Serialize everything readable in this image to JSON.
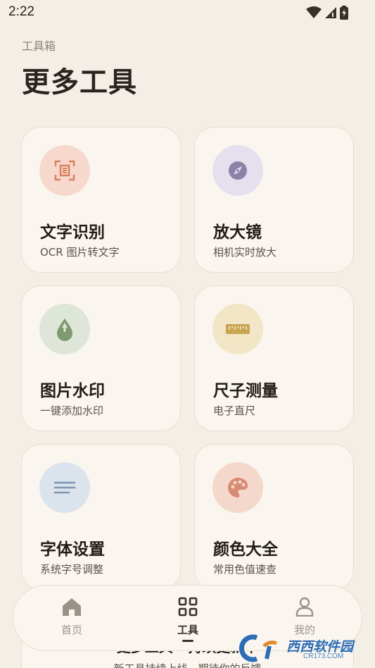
{
  "status_bar": {
    "time": "2:22"
  },
  "header": {
    "subtitle": "工具箱",
    "title": "更多工具"
  },
  "tools": [
    {
      "title": "文字识别",
      "desc": "OCR 图片转文字",
      "icon": "ocr-scan-icon",
      "icon_bg": "#f6d8cc"
    },
    {
      "title": "放大镜",
      "desc": "相机实时放大",
      "icon": "compass-icon",
      "icon_bg": "#e4e0ee"
    },
    {
      "title": "图片水印",
      "desc": "一键添加水印",
      "icon": "water-drop-icon",
      "icon_bg": "#dde6d8"
    },
    {
      "title": "尺子测量",
      "desc": "电子直尺",
      "icon": "ruler-icon",
      "icon_bg": "#f2e6c6"
    },
    {
      "title": "字体设置",
      "desc": "系统字号调整",
      "icon": "text-lines-icon",
      "icon_bg": "#dbe3ec"
    },
    {
      "title": "颜色大全",
      "desc": "常用色值速查",
      "icon": "palette-icon",
      "icon_bg": "#f4d8cc"
    }
  ],
  "more_banner": {
    "title": "更多工具 · 持续更新中",
    "desc": "新工具持续上线，期待你的反馈"
  },
  "bottom_nav": [
    {
      "label": "首页",
      "icon": "home-icon",
      "active": false
    },
    {
      "label": "工具",
      "icon": "grid-icon",
      "active": true
    },
    {
      "label": "我的",
      "icon": "person-icon",
      "active": false
    }
  ],
  "watermark": {
    "text": "西西软件园",
    "sub": "CR173.COM"
  },
  "colors": {
    "background": "#f4efe6",
    "card": "#faf6ef",
    "accent_text": "#221c18"
  }
}
